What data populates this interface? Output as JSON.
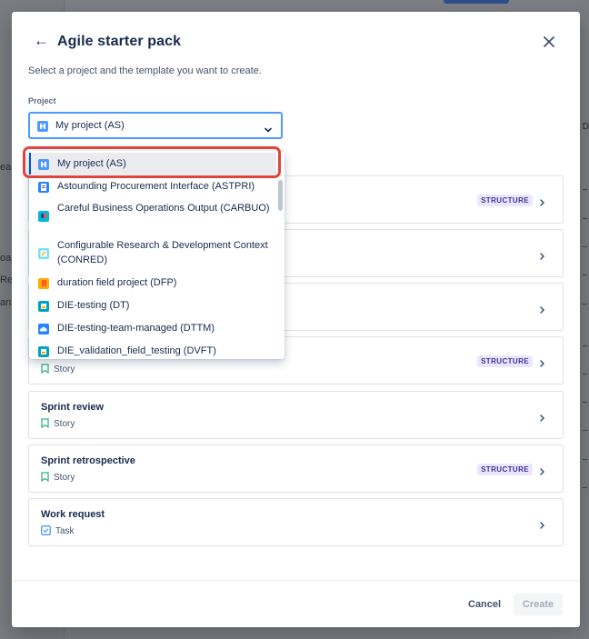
{
  "background": {
    "left_fragments": [
      "ea",
      "oa",
      "Re",
      "an"
    ],
    "right_fragment": "D"
  },
  "modal": {
    "title": "Agile starter pack",
    "subtitle": "Select a project and the template you want to create.",
    "project_label": "Project",
    "selected_project": "My project (AS)"
  },
  "dropdown": {
    "options": [
      {
        "label": "My project (AS)",
        "icon": "project-board-icon",
        "color": "#4c9aff",
        "selected": true
      },
      {
        "label": "Astounding Procurement Interface (ASTPRI)",
        "icon": "project-doc-icon",
        "color": "#2684ff"
      },
      {
        "label": "Careful Business Operations Output (CARBUO)",
        "icon": "project-flag-icon",
        "color": "#00b8d9"
      },
      {
        "label": "Configurable Research & Development Context (CONRED)",
        "icon": "project-note-icon",
        "color": "#79e2f2"
      },
      {
        "label": "duration field project (DFP)",
        "icon": "project-bookmark-icon",
        "color": "#ffab00"
      },
      {
        "label": "DIE-testing (DT)",
        "icon": "project-box-icon",
        "color": "#00a3bf"
      },
      {
        "label": "DIE-testing-team-managed (DTTM)",
        "icon": "project-cloud-icon",
        "color": "#2684ff"
      },
      {
        "label": "DIE_validation_field_testing (DVFT)",
        "icon": "project-box-icon",
        "color": "#00a3bf"
      }
    ]
  },
  "templates": [
    {
      "title": "",
      "type": "",
      "type_icon": "",
      "structure": true
    },
    {
      "title": "",
      "type": "",
      "type_icon": "",
      "structure": false
    },
    {
      "title": "",
      "type": "",
      "type_icon": "",
      "structure": false
    },
    {
      "title": "",
      "type": "Story",
      "type_icon": "story-icon",
      "structure": true
    },
    {
      "title": "Sprint review",
      "type": "Story",
      "type_icon": "story-icon",
      "structure": false
    },
    {
      "title": "Sprint retrospective",
      "type": "Story",
      "type_icon": "story-icon",
      "structure": true
    },
    {
      "title": "Work request",
      "type": "Task",
      "type_icon": "task-icon",
      "structure": false
    }
  ],
  "structure_badge": "STRUCTURE",
  "footer": {
    "cancel": "Cancel",
    "create": "Create"
  },
  "colors": {
    "accent": "#0052cc",
    "focus": "#4c9aff",
    "highlight": "#e0443b",
    "story": "#36b37e",
    "task": "#4c9aff",
    "badge_bg": "#eae6ff",
    "badge_fg": "#403294"
  }
}
